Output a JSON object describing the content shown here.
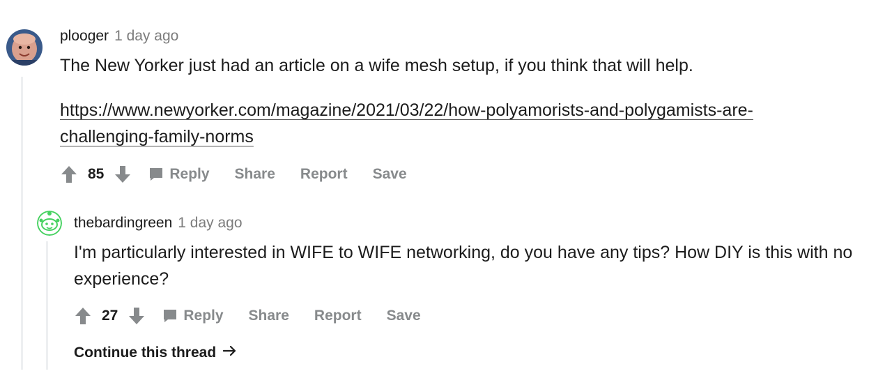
{
  "comment": {
    "username": "plooger",
    "time": "1 day ago",
    "text": "The New Yorker just had an article on a wife mesh setup, if you think that will help.",
    "link_line1": "https://www.newyorker.com/magazine/2021/03/22/how-polyamorists-and-polygamists-are-",
    "link_line2": "challenging-family-norms",
    "score": "85",
    "actions": {
      "reply": "Reply",
      "share": "Share",
      "report": "Report",
      "save": "Save"
    }
  },
  "reply": {
    "username": "thebardingreen",
    "time": "1 day ago",
    "text": "I'm particularly interested in WIFE to WIFE networking, do you have any tips? How DIY is this with no experience?",
    "score": "27",
    "actions": {
      "reply": "Reply",
      "share": "Share",
      "report": "Report",
      "save": "Save"
    },
    "continue_label": "Continue this thread"
  },
  "colors": {
    "text": "#1c1c1c",
    "meta": "#7c7c7c",
    "action": "#878a8c",
    "thread_line": "#edeff1",
    "snoo_green": "#46d160"
  },
  "icons": [
    "upvote-icon",
    "downvote-icon",
    "comment-icon",
    "snoo-avatar",
    "arrow-right-icon"
  ]
}
